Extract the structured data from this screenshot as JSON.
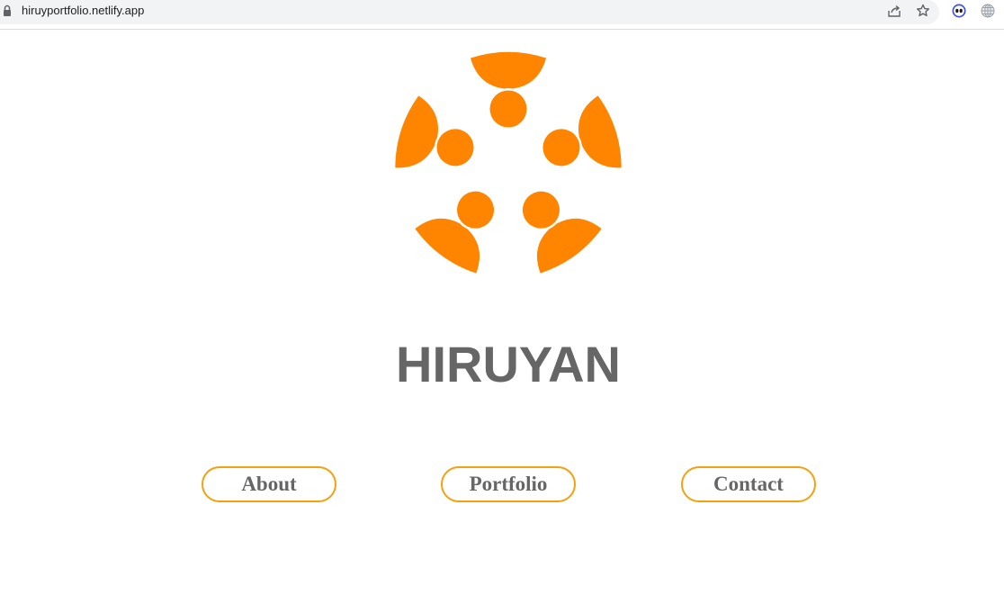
{
  "browser": {
    "url": "hiruyportfolio.netlify.app"
  },
  "icons": {
    "lock": "lock-icon",
    "share": "share-icon",
    "star": "bookmark-star-icon",
    "extension": "extension-eyes-icon",
    "globe": "globe-icon"
  },
  "colors": {
    "logo_orange": "#ff8400",
    "brand_text": "#666666",
    "button_border": "#f5a00e"
  },
  "page": {
    "brand_name": "HIRUYAN",
    "nav": [
      {
        "label": "About"
      },
      {
        "label": "Portfolio"
      },
      {
        "label": "Contact"
      }
    ]
  }
}
